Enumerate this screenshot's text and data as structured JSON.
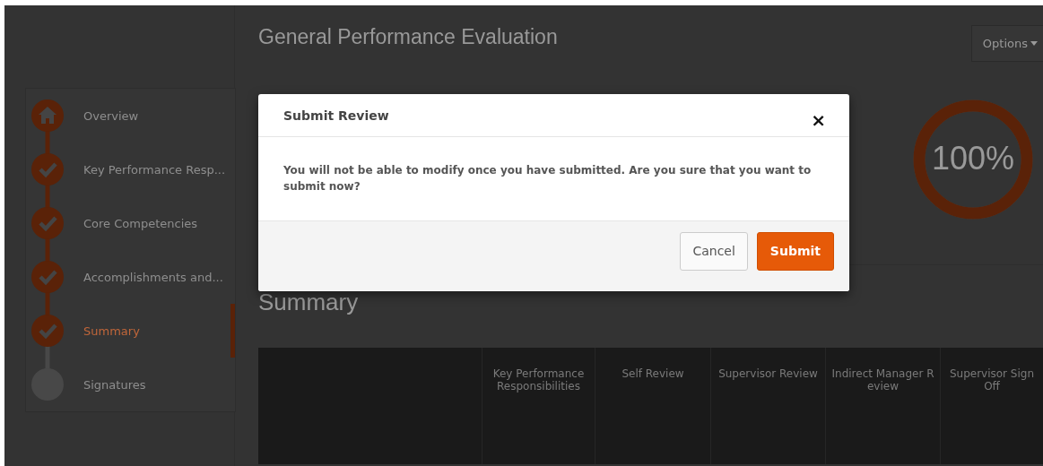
{
  "page": {
    "title": "General Performance Evaluation",
    "options_button": "Options"
  },
  "steps": [
    {
      "label": "Overview",
      "completed": true,
      "selected": false
    },
    {
      "label": "Key Performance Resp...",
      "completed": true,
      "selected": false
    },
    {
      "label": "Core Competencies",
      "completed": true,
      "selected": false
    },
    {
      "label": "Accomplishments and...",
      "completed": true,
      "selected": false
    },
    {
      "label": "Summary",
      "completed": true,
      "selected": true
    },
    {
      "label": "Signatures",
      "completed": false,
      "selected": false
    }
  ],
  "progress": {
    "level": 1,
    "reading": "100%"
  },
  "section_title": "Summary",
  "table": {
    "columns": [
      "Key Performance Responsibilities",
      "Self Review",
      "Supervisor Review",
      "Indirect Manager Review",
      "Supervisor Sign Off"
    ]
  },
  "dialog": {
    "title": "Submit Review",
    "close": "×",
    "message": "You will not be able to modify once you have submitted. Are you sure that you want to submit now?",
    "buttons": [
      {
        "label": "Cancel",
        "kind": "secondary"
      },
      {
        "label": "Submit",
        "kind": "primary"
      }
    ]
  }
}
